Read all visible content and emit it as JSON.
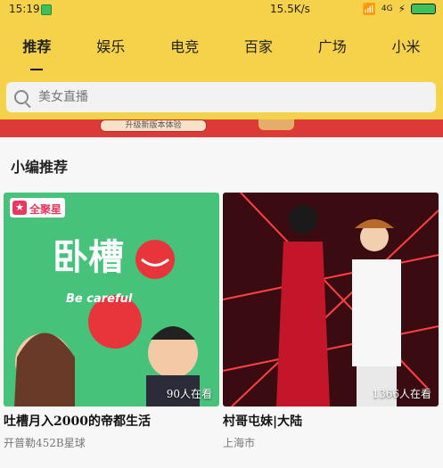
{
  "status_bar": {
    "time": "15:19",
    "network_speed": "15.5K/s",
    "signal": "4G",
    "battery_color": "#3fbf5a"
  },
  "tabs": [
    {
      "label": "推荐",
      "active": true
    },
    {
      "label": "娱乐",
      "active": false
    },
    {
      "label": "电竞",
      "active": false
    },
    {
      "label": "百家",
      "active": false
    },
    {
      "label": "广场",
      "active": false
    },
    {
      "label": "小米",
      "active": false
    }
  ],
  "search": {
    "placeholder": "美女直播"
  },
  "banner": {
    "text": "升级新版本体验"
  },
  "section": {
    "title": "小编推荐"
  },
  "cards": [
    {
      "title": "吐槽月入2000的帝都生活",
      "location": "开普勒452B星球",
      "viewers": "90人在看",
      "badge": "全聚星",
      "art_text": "卧槽",
      "art_sub": "Be careful"
    },
    {
      "title": "村哥屯妹|大陆",
      "location": "上海市",
      "viewers": "1366人在看"
    }
  ],
  "colors": {
    "header_bg": "#f6d24a",
    "banner_red": "#dc3a36",
    "card1_bg": "#46c27b",
    "card2_bg": "#3a0c12"
  }
}
